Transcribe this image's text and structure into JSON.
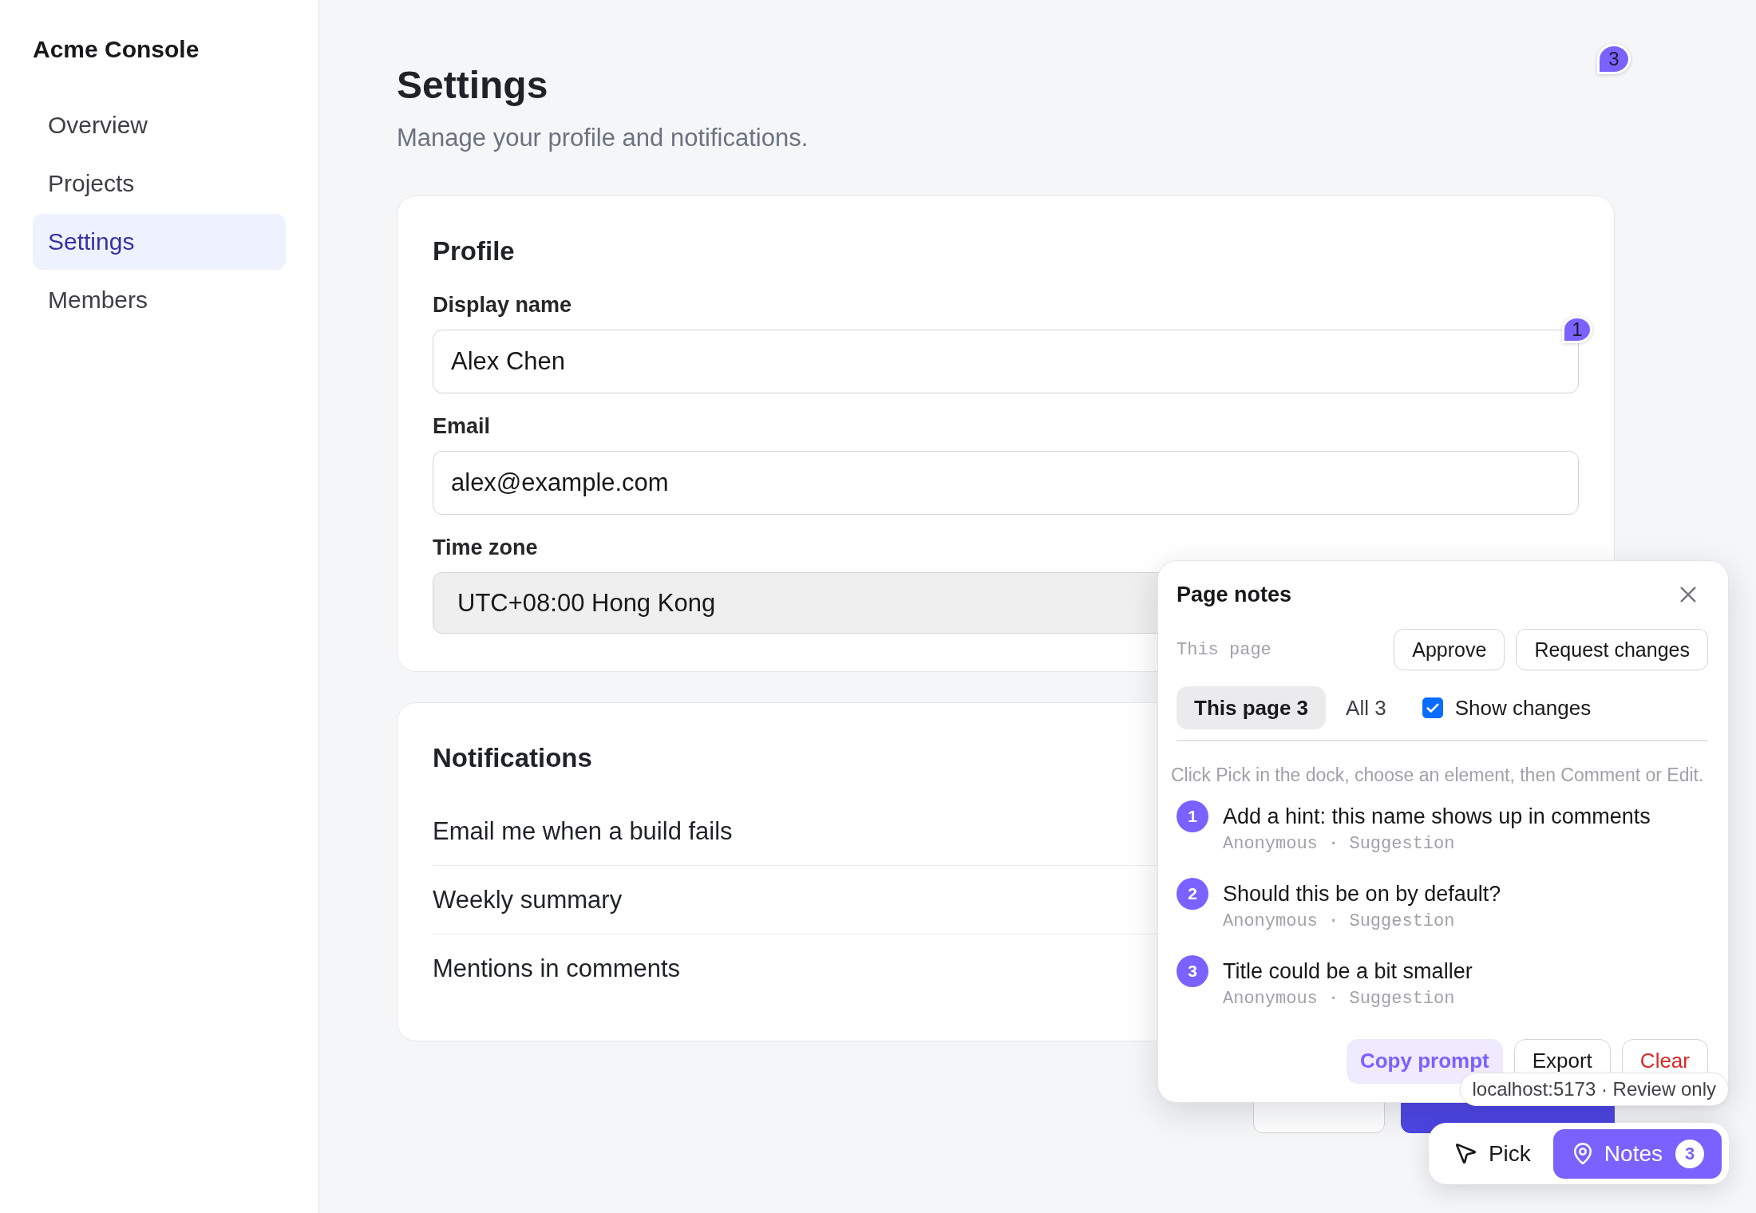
{
  "sidebar": {
    "brand": "Acme Console",
    "items": [
      {
        "label": "Overview",
        "selected": false
      },
      {
        "label": "Projects",
        "selected": false
      },
      {
        "label": "Settings",
        "selected": true
      },
      {
        "label": "Members",
        "selected": false
      }
    ]
  },
  "header": {
    "title": "Settings",
    "subtitle": "Manage your profile and notifications.",
    "pin": "3"
  },
  "profile": {
    "title": "Profile",
    "fields": [
      {
        "label": "Display name",
        "value": "Alex Chen",
        "kind": "text",
        "pin": "1"
      },
      {
        "label": "Email",
        "value": "alex@example.com",
        "kind": "text"
      },
      {
        "label": "Time zone",
        "value": "UTC+08:00 Hong Kong",
        "kind": "select"
      }
    ]
  },
  "notifications": {
    "title": "Notifications",
    "rows": [
      {
        "label": "Email me when a build fails"
      },
      {
        "label": "Weekly summary"
      },
      {
        "label": "Mentions in comments"
      }
    ]
  },
  "actions": [
    {
      "kind": "secondary"
    },
    {
      "kind": "primary"
    }
  ],
  "notes_panel": {
    "title": "Page notes",
    "scope": "This page",
    "review_buttons": [
      "Approve",
      "Request changes"
    ],
    "tabs": [
      {
        "label": "This page 3",
        "selected": true
      },
      {
        "label": "All 3",
        "selected": false
      }
    ],
    "show_changes": {
      "label": "Show changes",
      "checked": true
    },
    "hint": "Click Pick in the dock, choose an element, then Comment or Edit.",
    "notes": [
      {
        "number": "1",
        "text": "Add a hint: this name shows up in comments",
        "meta": "Anonymous · Suggestion"
      },
      {
        "number": "2",
        "text": "Should this be on by default?",
        "meta": "Anonymous · Suggestion"
      },
      {
        "number": "3",
        "text": "Title could be a bit smaller",
        "meta": "Anonymous · Suggestion"
      }
    ],
    "footer_buttons": [
      {
        "label": "Copy prompt",
        "kind": "accent"
      },
      {
        "label": "Export",
        "kind": "plain"
      },
      {
        "label": "Clear",
        "kind": "danger"
      }
    ]
  },
  "status_tooltip": "localhost:5173 · Review only",
  "dock": {
    "buttons": [
      {
        "label": "Pick",
        "kind": "pick",
        "selected": false
      },
      {
        "label": "Notes",
        "kind": "notes",
        "selected": true,
        "count": "3"
      }
    ]
  }
}
